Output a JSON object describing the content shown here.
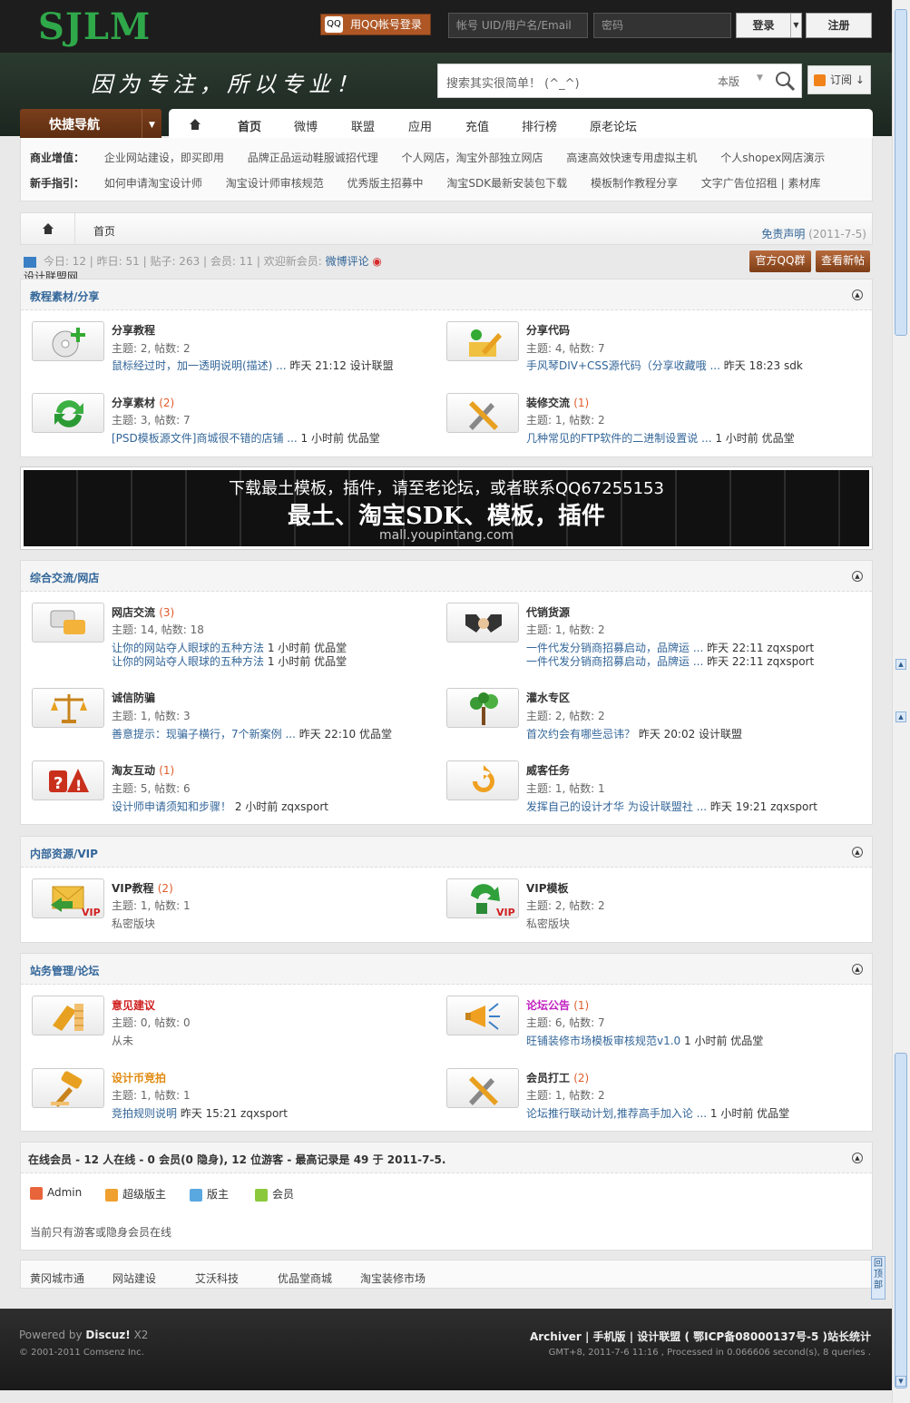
{
  "header": {
    "logo": "SJLM",
    "qq_login": "用QQ帐号登录",
    "uid_placeholder": "帐号   UID/用户名/Email",
    "pwd_placeholder": "密码",
    "login": "登录",
    "register": "注册"
  },
  "banner": {
    "slogan": "因为专注，所以专业！",
    "search_placeholder": "搜索其实很简单！ (^_^)",
    "scope": "本版",
    "rss": "订阅"
  },
  "nav": {
    "quick": "快捷导航",
    "items": [
      "首页",
      "微博",
      "联盟",
      "应用",
      "充值",
      "排行榜",
      "原老论坛"
    ]
  },
  "subnav": {
    "row1_label": "商业增值：",
    "row1": [
      "企业网站建设，即买即用",
      "品牌正品运动鞋服诚招代理",
      "个人网店，淘宝外部独立网店",
      "高速高效快速专用虚拟主机",
      "个人shopex网店演示"
    ],
    "row2_label": "新手指引：",
    "row2": [
      "如何申请淘宝设计师",
      "淘宝设计师审核规范",
      "优秀版主招募中",
      "淘宝SDK最新安装包下载",
      "模板制作教程分享",
      "文字广告位招租 | 素材库"
    ]
  },
  "crumb": {
    "home": "首页",
    "disclaimer": "免责声明",
    "date": "(2011-7-5)"
  },
  "stats": {
    "today": "今日: 12",
    "yesterday": "昨日: 51",
    "posts": "贴子: 263",
    "members": "会员: 11",
    "welcome": "欢迎新会员:",
    "new_member": "微博评论",
    "weibo": "设计联盟网",
    "btn_qq": "官方QQ群",
    "btn_new": "查看新帖"
  },
  "sections": [
    {
      "title": "教程素材/分享",
      "forums": [
        {
          "name": "分享教程",
          "count": "",
          "stats": "主题: 2, 帖数: 2",
          "last": "鼠标经过时，加一透明说明(描述) ...",
          "meta": "昨天 21:12 设计联盟"
        },
        {
          "name": "分享代码",
          "count": "",
          "stats": "主题: 4, 帖数: 7",
          "last": "手风琴DIV+CSS源代码（分享收藏哦 ...",
          "meta": "昨天 18:23 sdk"
        },
        {
          "name": "分享素材",
          "count": "(2)",
          "stats": "主题: 3, 帖数: 7",
          "last": "[PSD模板源文件]商城很不错的店铺 ...",
          "meta": "1 小时前 优品堂"
        },
        {
          "name": "装修交流",
          "count": "(1)",
          "stats": "主题: 1, 帖数: 2",
          "last": "几种常见的FTP软件的二进制设置说 ...",
          "meta": "1 小时前 优品堂"
        }
      ]
    },
    {
      "title": "综合交流/网店",
      "forums": [
        {
          "name": "网店交流",
          "count": "(3)",
          "stats": "主题: 14, 帖数: 18",
          "last": "让你的网站夺人眼球的五种方法",
          "meta": "1 小时前 优品堂",
          "last2": "让你的网站夺人眼球的五种方法",
          "meta2": "1 小时前 优品堂"
        },
        {
          "name": "代销货源",
          "count": "",
          "stats": "主题: 1, 帖数: 2",
          "last": "一件代发分销商招募启动，品牌运 ...",
          "meta": "昨天 22:11 zqxsport",
          "last2": "一件代发分销商招募启动，品牌运 ...",
          "meta2": "昨天 22:11 zqxsport"
        },
        {
          "name": "诚信防骗",
          "count": "",
          "stats": "主题: 1, 帖数: 3",
          "last": "善意提示：现骗子横行，7个新案例 ...",
          "meta": "昨天 22:10 优品堂"
        },
        {
          "name": "灌水专区",
          "count": "",
          "stats": "主题: 2, 帖数: 2",
          "last": "首次约会有哪些忌讳？",
          "meta": "昨天 20:02 设计联盟"
        },
        {
          "name": "淘友互动",
          "count": "(1)",
          "stats": "主题: 5, 帖数: 6",
          "last": "设计师申请须知和步骤！",
          "meta": "2 小时前 zqxsport"
        },
        {
          "name": "威客任务",
          "count": "",
          "stats": "主题: 1, 帖数: 1",
          "last": "发挥自己的设计才华 为设计联盟社 ...",
          "meta": "昨天 19:21 zqxsport"
        }
      ]
    },
    {
      "title": "内部资源/VIP",
      "forums": [
        {
          "name": "VIP教程",
          "count": "(2)",
          "stats": "主题: 1, 帖数: 1",
          "last": "",
          "meta": "私密版块"
        },
        {
          "name": "VIP模板",
          "count": "",
          "stats": "主题: 2, 帖数: 2",
          "last": "",
          "meta": "私密版块"
        }
      ]
    },
    {
      "title": "站务管理/论坛",
      "forums": [
        {
          "name": "意见建议",
          "count": "",
          "stats": "主题: 0, 帖数: 0",
          "last": "",
          "meta": "从未"
        },
        {
          "name": "论坛公告",
          "count": "(1)",
          "stats": "主题: 6, 帖数: 7",
          "last": "旺铺装修市场模板审核规范v1.0",
          "meta": "1 小时前 优品堂"
        },
        {
          "name": "设计币竞拍",
          "count": "",
          "stats": "主题: 1, 帖数: 1",
          "last": "竞拍规则说明",
          "meta": "昨天 15:21 zqxsport"
        },
        {
          "name": "会员打工",
          "count": "(2)",
          "stats": "主题: 1, 帖数: 2",
          "last": "论坛推行联动计划,推荐高手加入论 ...",
          "meta": "1 小时前 优品堂"
        }
      ]
    }
  ],
  "ad": {
    "line1": "下载最土模板，插件，请至老论坛，或者联系QQ67255153",
    "line2": "最土、淘宝SDK、模板，插件",
    "line3": "mall.youpintang.com"
  },
  "online": {
    "title": "在线会员 - 12 人在线 - 0 会员(0 隐身), 12 位游客 - 最高记录是 49 于 2011-7-5.",
    "legend": [
      "Admin",
      "超级版主",
      "版主",
      "会员"
    ],
    "note": "当前只有游客或隐身会员在线"
  },
  "links": [
    "黄冈城市通",
    "网站建设",
    "艾沃科技",
    "优品堂商城",
    "淘宝装修市场"
  ],
  "footer": {
    "powered": "Powered by",
    "brand": "Discuz!",
    "ver": "X2",
    "copyright": "© 2001-2011 Comsenz Inc.",
    "right": "Archiver | 手机版 | 设计联盟 ( 鄂ICP备08000137号-5 )站长统计",
    "meta": "GMT+8, 2011-7-6 11:16 , Processed in 0.066606 second(s), 8 queries ."
  },
  "totop": "回顶部"
}
